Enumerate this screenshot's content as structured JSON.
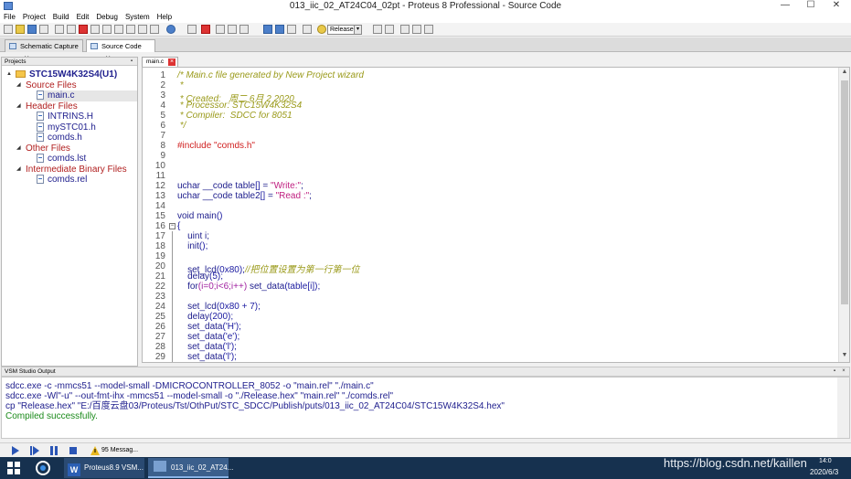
{
  "window": {
    "title": "013_iic_02_AT24C04_02pt - Proteus 8 Professional - Source Code",
    "minimize": "—",
    "maximize": "☐",
    "close": "✕"
  },
  "menu": [
    "File",
    "Project",
    "Build",
    "Edit",
    "Debug",
    "System",
    "Help"
  ],
  "toolbar": {
    "build_config": "Release",
    "icons": [
      "new-file-icon",
      "open-folder-icon",
      "save-icon",
      "close-project-icon",
      "home-icon",
      "schematic-icon",
      "pcb-icon",
      "gerber-icon",
      "3d-icon",
      "bom-icon",
      "source-code-icon",
      "help-icon",
      "component-icon",
      "delete-icon",
      "copy-icon",
      "paste-icon",
      "doc-icon",
      "build-icon",
      "rebuild-icon",
      "stop-icon",
      "options-icon",
      "undo-icon",
      "redo-icon",
      "cut-icon",
      "copy2-icon",
      "paste2-icon"
    ]
  },
  "tabs": [
    {
      "label": "Schematic Capture",
      "active": false
    },
    {
      "label": "Source Code",
      "active": true
    }
  ],
  "projects": {
    "header": "Projects",
    "root": "STC15W4K32S4(U1)",
    "groups": [
      {
        "name": "Source Files",
        "files": [
          "main.c"
        ]
      },
      {
        "name": "Header Files",
        "files": [
          "INTRINS.H",
          "mySTC01.h",
          "comds.h"
        ]
      },
      {
        "name": "Other Files",
        "files": [
          "comds.lst"
        ]
      },
      {
        "name": "Intermediate Binary Files",
        "files": [
          "comds.rel"
        ]
      }
    ]
  },
  "editor": {
    "file_tab": "main.c",
    "line_numbers": [
      "1",
      "2",
      "3",
      "4",
      "5",
      "6",
      "7",
      "8",
      "9",
      "10",
      "11",
      "12",
      "13",
      "14",
      "15",
      "16",
      "17",
      "18",
      "19",
      "20",
      "21",
      "22",
      "23",
      "24",
      "25",
      "26",
      "27",
      "28",
      "29"
    ],
    "lines": [
      [
        {
          "t": "/* Main.c file generated by New Project wizard",
          "c": "cmt"
        }
      ],
      [
        {
          "t": " *",
          "c": "cmt"
        }
      ],
      [
        {
          "t": " * Created:   周二 6月 2 2020",
          "c": "cmt"
        }
      ],
      [
        {
          "t": " * Processor: STC15W4K32S4",
          "c": "cmt"
        }
      ],
      [
        {
          "t": " * Compiler:  SDCC for 8051",
          "c": "cmt"
        }
      ],
      [
        {
          "t": " */",
          "c": "cmt"
        }
      ],
      [],
      [
        {
          "t": "#include ",
          "c": "pre"
        },
        {
          "t": "\"comds.h\"",
          "c": "pre"
        }
      ],
      [],
      [],
      [],
      [
        {
          "t": "uchar __code table",
          "c": "ident"
        },
        {
          "t": "[]",
          "c": "kw"
        },
        {
          "t": " = ",
          "c": "ident"
        },
        {
          "t": "\"Write:\"",
          "c": "str"
        },
        {
          "t": ";",
          "c": "ident"
        }
      ],
      [
        {
          "t": "uchar __code table2",
          "c": "ident"
        },
        {
          "t": "[]",
          "c": "kw"
        },
        {
          "t": " = ",
          "c": "ident"
        },
        {
          "t": "\"Read :\"",
          "c": "str"
        },
        {
          "t": ";",
          "c": "ident"
        }
      ],
      [],
      [
        {
          "t": "void main",
          "c": "ident"
        },
        {
          "t": "()",
          "c": "kw"
        }
      ],
      [
        {
          "t": "{",
          "c": "kw"
        }
      ],
      [
        {
          "t": "    uint i;",
          "c": "ident"
        }
      ],
      [
        {
          "t": "    init",
          "c": "ident"
        },
        {
          "t": "();",
          "c": "kw"
        }
      ],
      [],
      [
        {
          "t": "    set_lcd",
          "c": "ident"
        },
        {
          "t": "(0x80);",
          "c": "kw"
        },
        {
          "t": "//把位置设置为第一行第一位",
          "c": "cmtcn"
        }
      ],
      [
        {
          "t": "    delay",
          "c": "ident"
        },
        {
          "t": "(5);",
          "c": "kw"
        }
      ],
      [
        {
          "t": "    for",
          "c": "ident"
        },
        {
          "t": "(i=0;i<6;i++)",
          "c": "num"
        },
        {
          "t": " set_data",
          "c": "ident"
        },
        {
          "t": "(table[i]);",
          "c": "kw"
        }
      ],
      [],
      [
        {
          "t": "    set_lcd",
          "c": "ident"
        },
        {
          "t": "(0x80 + 7);",
          "c": "kw"
        }
      ],
      [
        {
          "t": "    delay",
          "c": "ident"
        },
        {
          "t": "(200);",
          "c": "kw"
        }
      ],
      [
        {
          "t": "    set_data",
          "c": "ident"
        },
        {
          "t": "('H');",
          "c": "kw"
        }
      ],
      [
        {
          "t": "    set_data",
          "c": "ident"
        },
        {
          "t": "('e');",
          "c": "kw"
        }
      ],
      [
        {
          "t": "    set_data",
          "c": "ident"
        },
        {
          "t": "('l');",
          "c": "kw"
        }
      ],
      [
        {
          "t": "    set_data",
          "c": "ident"
        },
        {
          "t": "('l');",
          "c": "kw"
        }
      ]
    ]
  },
  "output": {
    "header": "VSM Studio Output",
    "lines": [
      {
        "text": "sdcc.exe -c -mmcs51 --model-small -DMICROCONTROLLER_8052  -o \"main.rel\" \"./main.c\"",
        "kind": "cmd"
      },
      {
        "text": "sdcc.exe -Wl\"-u\" --out-fmt-ihx -mmcs51 --model-small  -o \"./Release.hex\" \"main.rel\" \"./comds.rel\"",
        "kind": "cmd"
      },
      {
        "text": "cp \"Release.hex\" \"E:/百度云盘03/Proteus/Tst/OthPut/STC_SDCC/Publish/puts/013_iic_02_AT24C04/STC15W4K32S4.hex\"",
        "kind": "cmd"
      },
      {
        "text": "Compiled successfully.",
        "kind": "ok"
      }
    ]
  },
  "status": {
    "messages": "95 Messag..."
  },
  "taskbar": {
    "items": [
      "Proteus8.9 VSM...",
      "013_iic_02_AT24..."
    ],
    "watermark": "https://blog.csdn.net/kaillen",
    "date": "2020/6/3",
    "time": "14:0"
  }
}
